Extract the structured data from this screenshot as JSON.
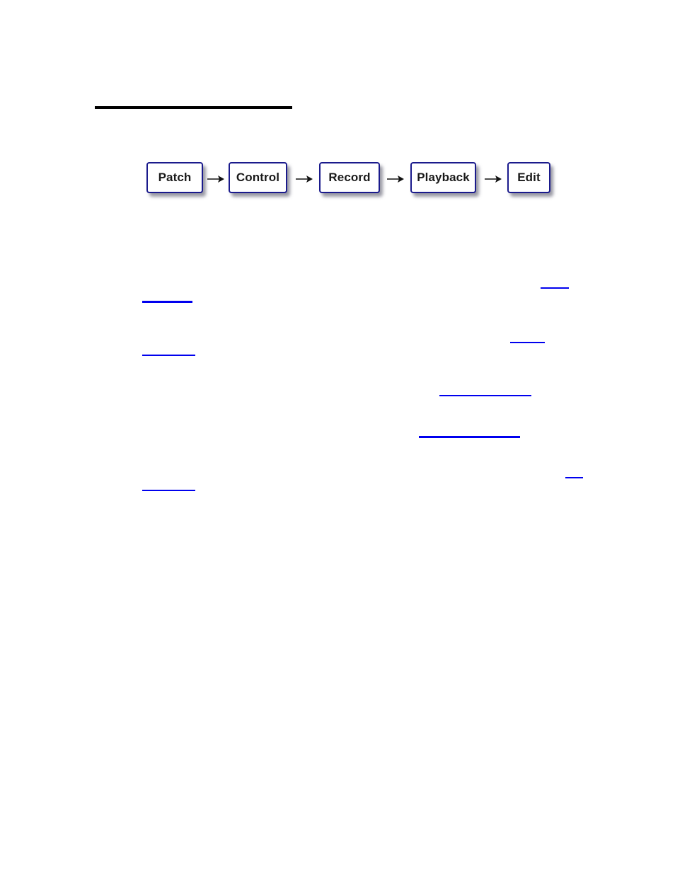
{
  "workflow": {
    "steps": [
      {
        "label": "Patch"
      },
      {
        "label": "Control"
      },
      {
        "label": "Record"
      },
      {
        "label": "Playback"
      },
      {
        "label": "Edit"
      }
    ],
    "connector_icon": "right-arrow-icon"
  },
  "colors": {
    "box_border": "#1a1a8c",
    "link": "#0000ee",
    "rule": "#000000"
  }
}
